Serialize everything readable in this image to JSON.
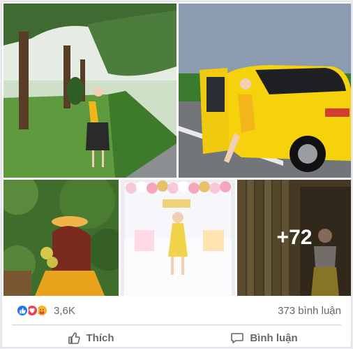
{
  "photos": {
    "more_count": "+72"
  },
  "stats": {
    "reaction_icons": [
      "like-icon",
      "love-icon",
      "care-icon"
    ],
    "reaction_count": "3,6K",
    "comment_count": "373 bình luận"
  },
  "actions": {
    "like_label": "Thích",
    "comment_label": "Bình luận"
  },
  "colors": {
    "like_blue": "#1877f2",
    "love_red": "#f33e58",
    "care_yellow": "#f7b125",
    "secondary_text": "#65676b"
  }
}
